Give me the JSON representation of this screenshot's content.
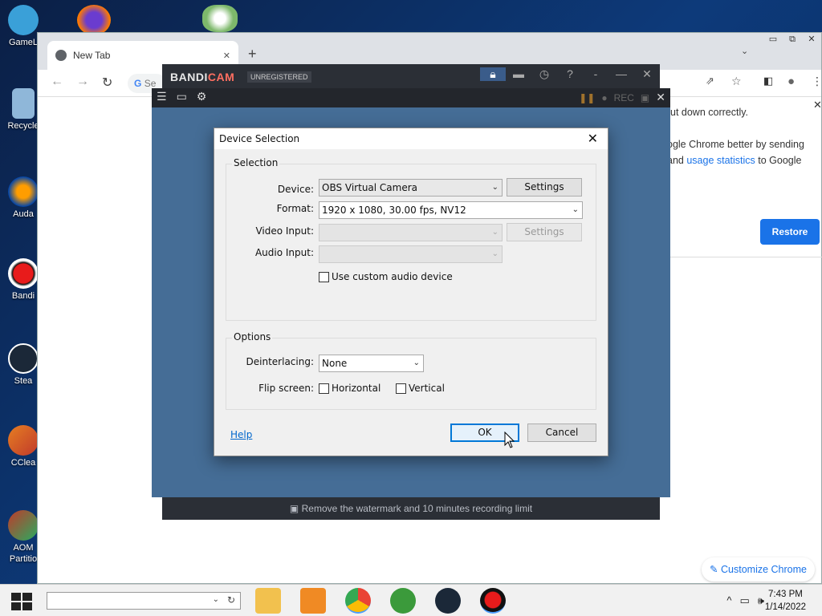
{
  "desktop": {
    "icons": [
      {
        "label": "GameL",
        "color": "#3aa0d8"
      },
      {
        "label": "Recycle",
        "color": "#6ea9d6"
      },
      {
        "label": "Auda",
        "color": "#ff8a00"
      },
      {
        "label": "Bandi",
        "color": "#e81b1b"
      },
      {
        "label": "Stea",
        "color": "#1b2838"
      },
      {
        "label": "CClea",
        "color": "#c0392b"
      },
      {
        "label": "AOM",
        "sublabel": "Partitio",
        "color": "#c0392b"
      }
    ]
  },
  "chrome": {
    "tab_title": "New Tab",
    "tab_close": "✕",
    "new_tab": "+",
    "omnibox_partial": "Se",
    "restore_text_1": "ut down correctly.",
    "restore_text_2": "ogle Chrome better by sending",
    "restore_text_3a": "and ",
    "restore_text_3_link": "usage statistics",
    "restore_text_3b": " to Google",
    "restore_button": "Restore",
    "customize_button": "Customize Chrome",
    "link_color": "#1a73e8"
  },
  "bandicam": {
    "logo_main": "BANDI",
    "logo_accent": "CAM",
    "unregistered": "UNREGISTERED",
    "footer_text": "Remove the watermark and 10 minutes recording limit",
    "rec_label": "REC"
  },
  "dialog": {
    "title": "Device Selection",
    "selection_group": "Selection",
    "device_label": "Device:",
    "device_value": "OBS Virtual Camera",
    "device_settings": "Settings",
    "format_label": "Format:",
    "format_value": "1920 x 1080, 30.00 fps, NV12",
    "video_input_label": "Video Input:",
    "video_input_value": "",
    "video_settings": "Settings",
    "audio_input_label": "Audio Input:",
    "audio_input_value": "",
    "custom_audio_label": "Use custom audio device",
    "options_group": "Options",
    "deinterlacing_label": "Deinterlacing:",
    "deinterlacing_value": "None",
    "flip_label": "Flip screen:",
    "horizontal_label": "Horizontal",
    "vertical_label": "Vertical",
    "help": "Help",
    "ok": "OK",
    "cancel": "Cancel"
  },
  "taskbar": {
    "time": "7:43 PM",
    "date": "1/14/2022",
    "apps": [
      {
        "name": "file-explorer",
        "color": "#f2c14e"
      },
      {
        "name": "media-player",
        "color": "#f08a24"
      },
      {
        "name": "chrome",
        "color": "#4285f4"
      },
      {
        "name": "utorrent",
        "color": "#3b9a3b"
      },
      {
        "name": "steam",
        "color": "#1b2838"
      },
      {
        "name": "bandicam",
        "color": "#e81b1b"
      }
    ]
  }
}
